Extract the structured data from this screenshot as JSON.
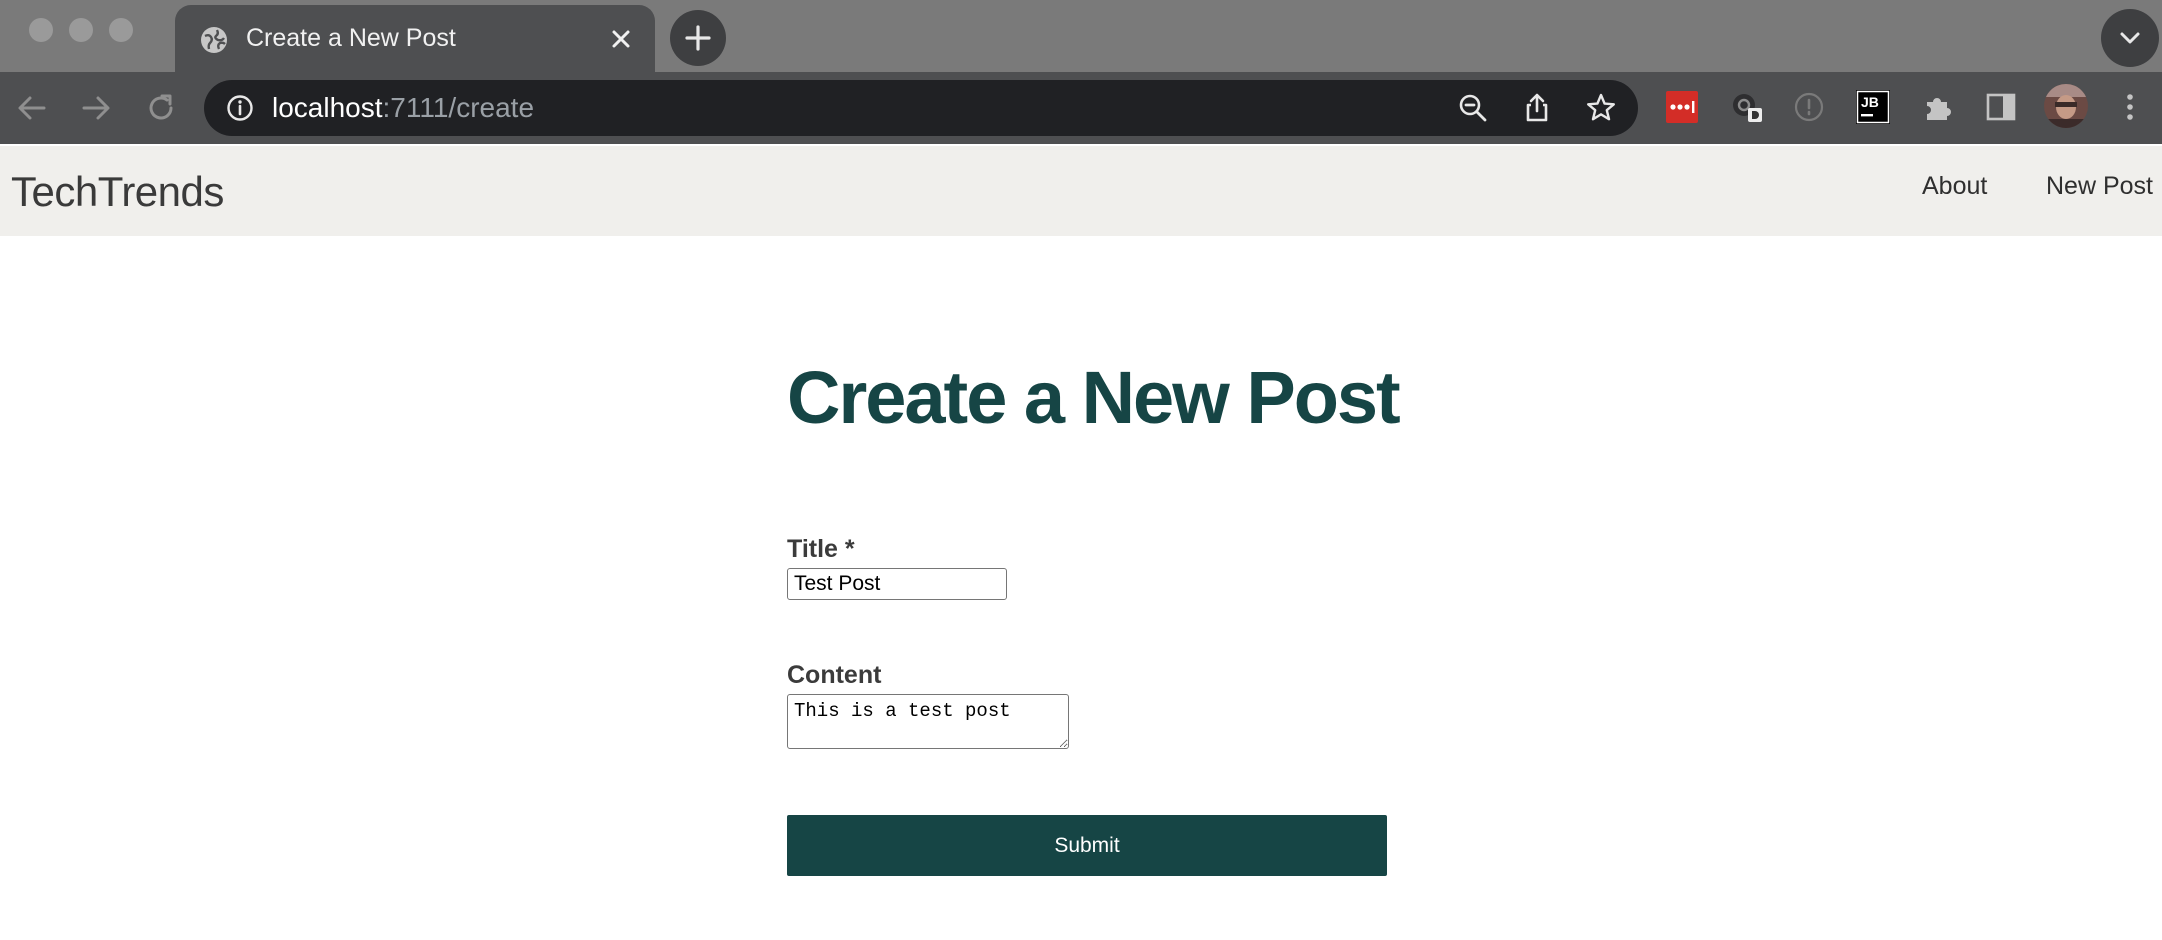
{
  "browser": {
    "tab": {
      "title": "Create a New Post"
    },
    "address_bar": {
      "host": "localhost",
      "path": ":7111/create"
    },
    "colors": {
      "chrome_dark": "#4e4f51",
      "omnibox": "#202124",
      "tabstrip": "#7a7a7a"
    }
  },
  "site": {
    "brand": "TechTrends",
    "nav": {
      "about": "About",
      "new_post": "New Post"
    },
    "colors": {
      "accent": "#164545",
      "nav_bg": "#f0efec"
    }
  },
  "form": {
    "heading": "Create a New Post",
    "title": {
      "label": "Title *",
      "value": "Test Post"
    },
    "content": {
      "label": "Content",
      "value": "This is a test post"
    },
    "submit_label": "Submit"
  },
  "icons": {
    "tab": "globe-icon",
    "close": "close-icon",
    "new_tab": "plus-icon",
    "tab_search": "chevron-down-icon",
    "back": "back-arrow-icon",
    "forward": "forward-arrow-icon",
    "reload": "reload-icon",
    "site_info": "info-icon",
    "zoom": "zoom-out-icon",
    "share": "share-icon",
    "bookmark": "star-icon",
    "extensions": [
      "lastpass-extension-icon",
      "camera-extension-icon",
      "history-extension-icon",
      "jetbrains-extension-icon",
      "puzzle-extensions-icon",
      "side-panel-icon",
      "profile-avatar-icon",
      "kebab-menu-icon"
    ]
  }
}
